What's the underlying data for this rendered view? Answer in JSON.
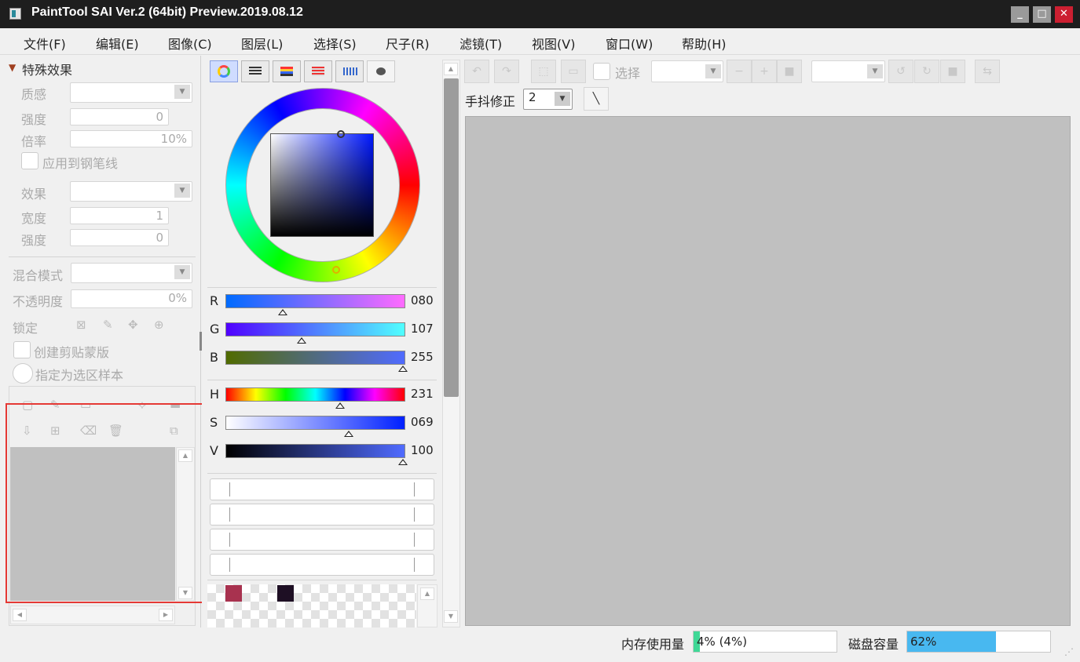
{
  "window": {
    "title": "PaintTool SAI Ver.2 (64bit) Preview.2019.08.12",
    "minimize": "_",
    "maximize": "□",
    "close": "✕"
  },
  "menu": [
    {
      "label": "文件(F)"
    },
    {
      "label": "编辑(E)"
    },
    {
      "label": "图像(C)"
    },
    {
      "label": "图层(L)"
    },
    {
      "label": "选择(S)"
    },
    {
      "label": "尺子(R)"
    },
    {
      "label": "滤镜(T)"
    },
    {
      "label": "视图(V)"
    },
    {
      "label": "窗口(W)"
    },
    {
      "label": "帮助(H)"
    }
  ],
  "effects": {
    "header": "特殊效果",
    "texture_label": "质感",
    "strength_label": "强度",
    "strength_value": "0",
    "scale_label": "倍率",
    "scale_value": "10%",
    "apply_pen_label": "应用到钢笔线",
    "effect_label": "效果",
    "width_label": "宽度",
    "width_value": "1",
    "strength2_label": "强度",
    "strength2_value": "0"
  },
  "layer": {
    "blend_label": "混合模式",
    "opacity_label": "不透明度",
    "opacity_value": "0%",
    "lock_label": "锁定",
    "clip_label": "创建剪贴蒙版",
    "sample_label": "指定为选区样本"
  },
  "color": {
    "R": {
      "label": "R",
      "value": "080"
    },
    "G": {
      "label": "G",
      "value": "107"
    },
    "B": {
      "label": "B",
      "value": "255"
    },
    "H": {
      "label": "H",
      "value": "231"
    },
    "S": {
      "label": "S",
      "value": "069"
    },
    "V": {
      "label": "V",
      "value": "100"
    },
    "swatches": [
      "#a8324f",
      "#1e0f24"
    ]
  },
  "canvas_toolbar": {
    "select_label": "选择",
    "stabilizer_label": "手抖修正",
    "stabilizer_value": "2"
  },
  "status": {
    "memory_label": "内存使用量",
    "memory_value": "4% (4%)",
    "memory_fraction": 0.04,
    "disk_label": "磁盘容量",
    "disk_value": "62%",
    "disk_fraction": 0.62
  }
}
